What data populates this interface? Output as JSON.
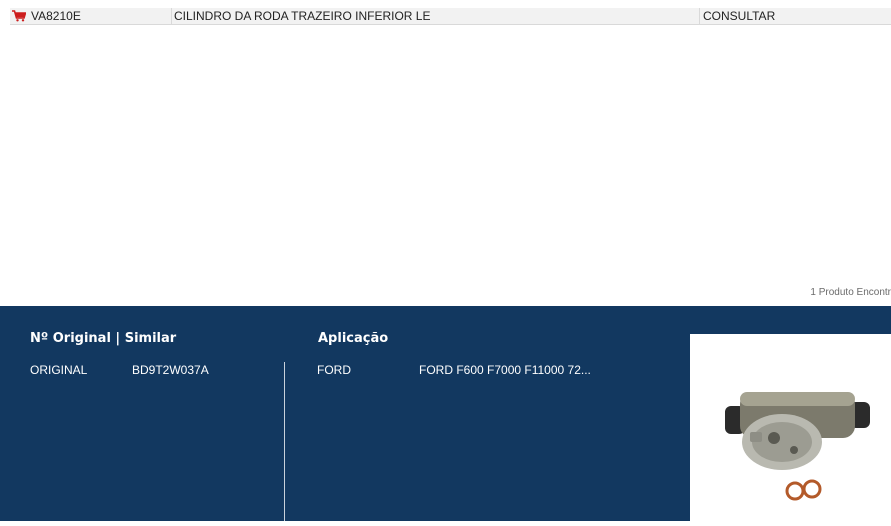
{
  "results": {
    "rows": [
      {
        "code": "VA8210E",
        "description": "CILINDRO DA RODA TRAZEIRO INFERIOR LE",
        "price": "CONSULTAR"
      }
    ],
    "count_text": "1 Produto Encontr"
  },
  "details": {
    "original_header": "Nº Original | Similar",
    "aplicacao_header": "Aplicação",
    "original_type": "ORIGINAL",
    "original_number": "BD9T2W037A",
    "brand": "FORD",
    "application": "FORD F600 F7000 F11000 72..."
  },
  "colors": {
    "panel_bg": "#123860",
    "row_bg": "#f2f2f2",
    "cart_red": "#cc1d1d"
  },
  "icons": {
    "cart": "shopping-cart-icon"
  }
}
